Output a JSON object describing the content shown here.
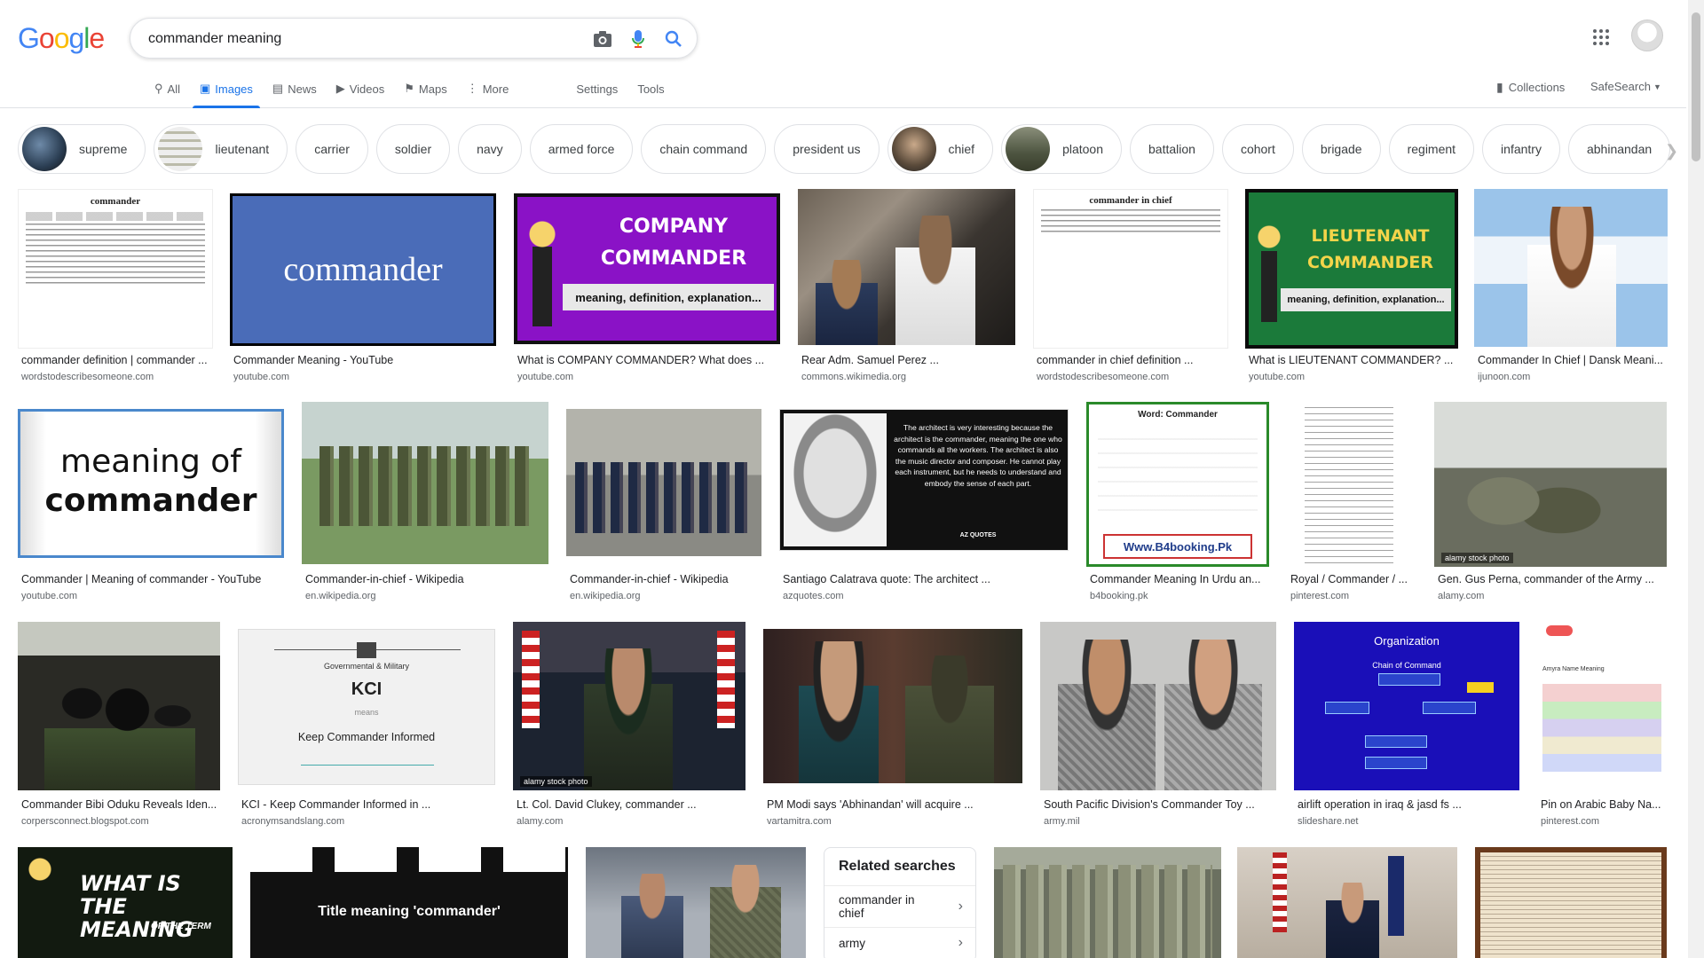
{
  "logo": {
    "text": "Google"
  },
  "search": {
    "value": "commander meaning",
    "placeholder": ""
  },
  "tabs": [
    {
      "label": "All",
      "icon": "search-icon"
    },
    {
      "label": "Images",
      "icon": "image-icon"
    },
    {
      "label": "News",
      "icon": "news-icon"
    },
    {
      "label": "Videos",
      "icon": "video-icon"
    },
    {
      "label": "Maps",
      "icon": "map-icon"
    },
    {
      "label": "More",
      "icon": "more-vert-icon"
    },
    {
      "label": "Settings"
    },
    {
      "label": "Tools"
    }
  ],
  "toolbar": {
    "collections": "Collections",
    "safesearch": "SafeSearch"
  },
  "chips": [
    "supreme",
    "lieutenant",
    "carrier",
    "soldier",
    "navy",
    "armed force",
    "chain command",
    "president us",
    "chief",
    "platoon",
    "battalion",
    "cohort",
    "brigade",
    "regiment",
    "infantry",
    "abhinandan"
  ],
  "results": [
    {
      "title": "commander definition | commander ...",
      "source": "wordstodescribesomeone.com",
      "img_text": "commander"
    },
    {
      "title": "Commander Meaning - YouTube",
      "source": "youtube.com",
      "img_text": "commander"
    },
    {
      "title": "What is COMPANY COMMANDER? What does ...",
      "source": "youtube.com",
      "img_text": "COMPANY COMMANDER",
      "img_sub": "meaning, definition, explanation..."
    },
    {
      "title": "Rear Adm. Samuel Perez ...",
      "source": "commons.wikimedia.org"
    },
    {
      "title": "commander in chief definition ...",
      "source": "wordstodescribesomeone.com",
      "img_text": "commander in chief"
    },
    {
      "title": "What is LIEUTENANT COMMANDER? ...",
      "source": "youtube.com",
      "img_text": "LIEUTENANT COMMANDER",
      "img_sub": "meaning, definition, explanation..."
    },
    {
      "title": "Commander In Chief | Dansk Meani...",
      "source": "ijunoon.com"
    },
    {
      "title": "Commander | Meaning of commander - YouTube",
      "source": "youtube.com",
      "img_text": "meaning of",
      "img_text2": "commander"
    },
    {
      "title": "Commander-in-chief - Wikipedia",
      "source": "en.wikipedia.org"
    },
    {
      "title": "Commander-in-chief - Wikipedia",
      "source": "en.wikipedia.org"
    },
    {
      "title": "Santiago Calatrava quote: The architect ...",
      "source": "azquotes.com",
      "img_text": "The architect is very interesting because the architect is the commander, meaning the one who commands all the workers. The architect is also the music director and composer. He cannot play each instrument, but he needs to understand and embody the sense of each part.",
      "img_sub": "AZ QUOTES"
    },
    {
      "title": "Commander Meaning In Urdu an...",
      "source": "b4booking.pk",
      "img_text": "Word: Commander",
      "img_sub": "Www.B4booking.Pk"
    },
    {
      "title": "Royal / Commander / ...",
      "source": "pinterest.com"
    },
    {
      "title": "Gen. Gus Perna, commander of the Army ...",
      "source": "alamy.com",
      "img_sub": "alamy stock photo"
    },
    {
      "title": "Commander Bibi Oduku Reveals Iden...",
      "source": "corpersconnect.blogspot.com"
    },
    {
      "title": "KCI - Keep Commander Informed in ...",
      "source": "acronymsandslang.com",
      "img_text": "KCI",
      "img_text2": "Keep Commander Informed",
      "img_sub": "Governmental & Military",
      "img_means": "means"
    },
    {
      "title": "Lt. Col. David Clukey, commander ...",
      "source": "alamy.com",
      "img_sub": "alamy stock photo"
    },
    {
      "title": "PM Modi says 'Abhinandan' will acquire ...",
      "source": "vartamitra.com"
    },
    {
      "title": "South Pacific Division's Commander Toy ...",
      "source": "army.mil"
    },
    {
      "title": "airlift operation in iraq & jasd fs ...",
      "source": "slideshare.net",
      "img_text": "Organization",
      "img_sub": "Chain of Command"
    },
    {
      "title": "Pin on Arabic Baby Na...",
      "source": "pinterest.com",
      "img_text": "Amyra Name Meaning"
    },
    {
      "img_text": "WHAT IS THE MEANING",
      "img_sub": "OF THE TERM"
    },
    {
      "img_text": "Title meaning 'commander'"
    }
  ],
  "related": {
    "title": "Related searches",
    "items": [
      "commander in chief",
      "army"
    ]
  },
  "colors": {
    "accent": "#1a73e8",
    "text_secondary": "#5f6368",
    "border": "#dfe1e5"
  }
}
